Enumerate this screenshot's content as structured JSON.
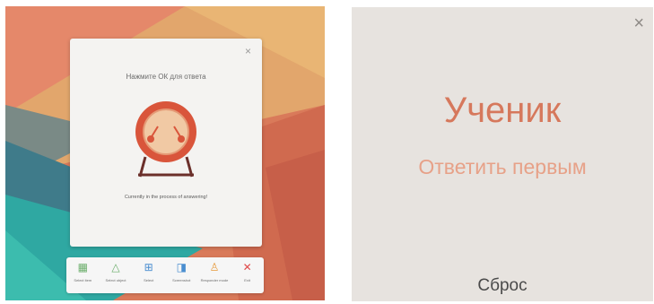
{
  "left_panel": {
    "dialog": {
      "close_glyph": "×",
      "title": "Нажмите ОК для ответа",
      "icon": "drum-icon",
      "status": "Currently in the process of answering!"
    },
    "toolbar": {
      "items": [
        {
          "label": "Select item",
          "icon": "grid-icon",
          "glyph": "▦",
          "color": "#6cae6c"
        },
        {
          "label": "Select object",
          "icon": "triangle-icon",
          "glyph": "△",
          "color": "#6cae6c"
        },
        {
          "label": "Select",
          "icon": "frame-icon",
          "glyph": "⊞",
          "color": "#4a8ed0"
        },
        {
          "label": "Screenshot",
          "icon": "screenshot-icon",
          "glyph": "◨",
          "color": "#4a8ed0"
        },
        {
          "label": "Responder mode",
          "icon": "person-icon",
          "glyph": "♙",
          "color": "#e69a3c"
        },
        {
          "label": "Exit",
          "icon": "close-icon",
          "glyph": "✕",
          "color": "#e04a4a"
        }
      ]
    },
    "colors": {
      "drum_red": "#d9553b",
      "drum_face": "#f1c9a4",
      "drum_stand": "#6b2f2a"
    }
  },
  "right_panel": {
    "close_glyph": "×",
    "title": "Ученик",
    "subtitle": "Ответить первым",
    "reset_label": "Сброс",
    "colors": {
      "title": "#d6785c",
      "subtitle": "#e7a188",
      "background": "#e7e3df"
    }
  }
}
